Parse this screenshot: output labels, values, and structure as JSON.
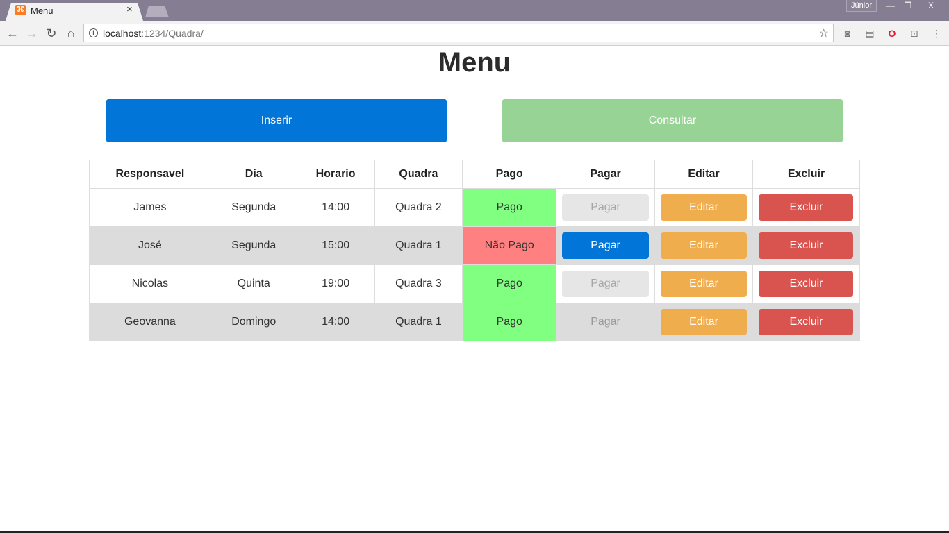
{
  "browser": {
    "tab_title": "Menu",
    "tab_close": "×",
    "profile": "Júnior",
    "url_host": "localhost",
    "url_path": ":1234/Quadra/",
    "win_minimize": "—",
    "win_restore": "❐",
    "win_close": "X"
  },
  "page": {
    "title": "Menu",
    "insert_label": "Inserir",
    "consult_label": "Consultar"
  },
  "table": {
    "headers": [
      "Responsavel",
      "Dia",
      "Horario",
      "Quadra",
      "Pago",
      "Pagar",
      "Editar",
      "Excluir"
    ],
    "rows": [
      {
        "responsavel": "James",
        "dia": "Segunda",
        "horario": "14:00",
        "quadra": "Quadra 2",
        "pago": "Pago",
        "pagar": "Pagar",
        "editar": "Editar",
        "excluir": "Excluir"
      },
      {
        "responsavel": "José",
        "dia": "Segunda",
        "horario": "15:00",
        "quadra": "Quadra 1",
        "pago": "Não Pago",
        "pagar": "Pagar",
        "editar": "Editar",
        "excluir": "Excluir"
      },
      {
        "responsavel": "Nicolas",
        "dia": "Quinta",
        "horario": "19:00",
        "quadra": "Quadra 3",
        "pago": "Pago",
        "pagar": "Pagar",
        "editar": "Editar",
        "excluir": "Excluir"
      },
      {
        "responsavel": "Geovanna",
        "dia": "Domingo",
        "horario": "14:00",
        "quadra": "Quadra 1",
        "pago": "Pago",
        "pagar": "Pagar",
        "editar": "Editar",
        "excluir": "Excluir"
      }
    ]
  },
  "colors": {
    "primary": "#0275d8",
    "success_light": "#97d395",
    "paid": "#80ff80",
    "unpaid": "#ff8080",
    "warning": "#f0ad4e",
    "danger": "#d9534f"
  }
}
